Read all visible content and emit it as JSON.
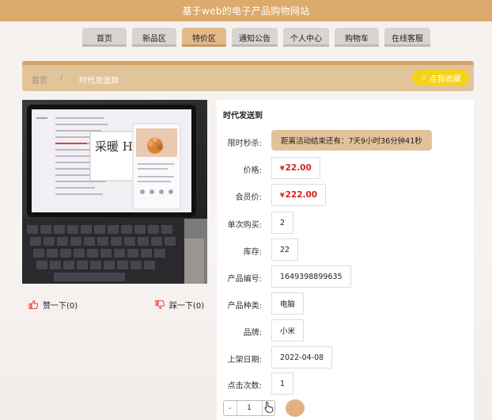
{
  "site": {
    "title": "基于web的电子产品购物网站"
  },
  "nav": {
    "items": [
      {
        "label": "首页"
      },
      {
        "label": "新品区"
      },
      {
        "label": "特价区"
      },
      {
        "label": "通知公告"
      },
      {
        "label": "个人中心"
      },
      {
        "label": "购物车"
      },
      {
        "label": "在线客服"
      }
    ],
    "active_index": 2
  },
  "breadcrumb": {
    "home": "首页",
    "separator": "/",
    "current": "时代发送到"
  },
  "favorite_button": {
    "label": "点我收藏",
    "icon": "star-icon"
  },
  "product": {
    "title": "时代发送到",
    "image_handwriting": "采暖 HO",
    "like_label": "赞一下(0)",
    "dislike_label": "踩一下(0)",
    "fields": {
      "flash_label": "限时秒杀:",
      "flash_countdown": "距离活动结束还有：7天9小时36分钟41秒",
      "price_label": "价格:",
      "price_currency": "¥",
      "price_value": "22.00",
      "member_price_label": "会员价:",
      "member_price_currency": "¥",
      "member_price_value": "222.00",
      "single_purchase_label": "单次购买:",
      "single_purchase_value": "2",
      "stock_label": "库存:",
      "stock_value": "22",
      "code_label": "产品编号:",
      "code_value": "1649398899635",
      "category_label": "产品种类:",
      "category_value": "电脑",
      "brand_label": "品牌:",
      "brand_value": "小米",
      "date_label": "上架日期:",
      "date_value": "2022-04-08",
      "clicks_label": "点击次数:",
      "clicks_value": "1"
    },
    "quantity": {
      "minus": "-",
      "value": "1",
      "plus": "+"
    }
  },
  "colors": {
    "topbar": "#dcaa6b",
    "active_tab": "#e4b98a",
    "breadcrumb_bar": "#e2c49b",
    "favorite_button": "#f5d21a",
    "price_red": "#d81e1e",
    "like_icon": "#e8453c"
  }
}
